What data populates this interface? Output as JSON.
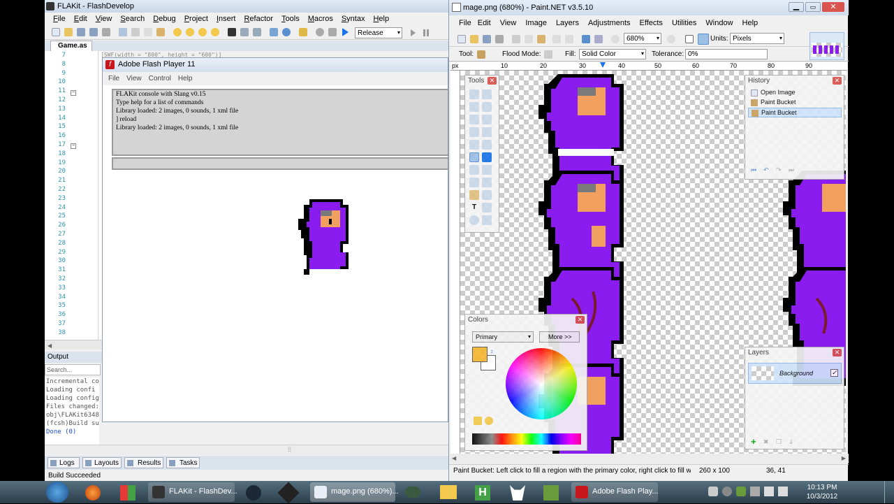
{
  "flashdevelop": {
    "title": "FLAKit - FlashDevelop",
    "menu": [
      "File",
      "Edit",
      "View",
      "Search",
      "Debug",
      "Project",
      "Insert",
      "Refactor",
      "Tools",
      "Macros",
      "Syntax",
      "Help"
    ],
    "config": "Release",
    "tab": "Game.as",
    "code_snippet": "[SWF(width = \"800\", height = \"600\")]",
    "line_numbers": [
      "7",
      "8",
      "9",
      "10",
      "11",
      "12",
      "13",
      "14",
      "15",
      "16",
      "17",
      "18",
      "19",
      "20",
      "21",
      "22",
      "23",
      "24",
      "25",
      "26",
      "27",
      "28",
      "29",
      "30",
      "31",
      "32",
      "33",
      "34",
      "35",
      "36",
      "37",
      "38"
    ],
    "output_title": "Output",
    "search_placeholder": "Search...",
    "output_lines": [
      "Incremental co",
      "Loading confi",
      "Loading config",
      "Files changed:",
      "obj\\FLAKit6348",
      "(fcsh)Build succeeded",
      "Done (0)"
    ],
    "bottom_tabs": [
      "Logs",
      "Layouts",
      "Results",
      "Tasks"
    ],
    "status": "Build Succeeded"
  },
  "flash_player": {
    "title": "Adobe Flash Player 11",
    "menu": [
      "File",
      "View",
      "Control",
      "Help"
    ],
    "console_lines": [
      "FLAKit console with Slang v0.15",
      "Type help for a list of commands",
      "Library loaded: 2 images, 0 sounds, 1 xml file",
      "] reload",
      "Library loaded: 2 images, 0 sounds, 1 xml file"
    ]
  },
  "paintnet": {
    "title": "mage.png (680%) - Paint.NET v3.5.10",
    "menu": [
      "File",
      "Edit",
      "View",
      "Image",
      "Layers",
      "Adjustments",
      "Effects",
      "Utilities",
      "Window",
      "Help"
    ],
    "zoom": "680%",
    "units_label": "Units:",
    "units": "Pixels",
    "tool_label": "Tool:",
    "flood_mode_label": "Flood Mode:",
    "fill_label": "Fill:",
    "fill": "Solid Color",
    "tolerance_label": "Tolerance:",
    "tolerance": "0%",
    "ruler_unit": "px",
    "ruler_ticks": [
      "10",
      "20",
      "30",
      "40",
      "50",
      "60",
      "70",
      "80",
      "90"
    ],
    "tools_title": "Tools",
    "history_title": "History",
    "history_items": [
      "Open Image",
      "Paint Bucket",
      "Paint Bucket"
    ],
    "colors_title": "Colors",
    "colors_mode": "Primary",
    "colors_more": "More >>",
    "layers_title": "Layers",
    "layer_name": "Background",
    "status_text": "Paint Bucket: Left click to fill a region with the primary color, right click to fill w",
    "image_size": "260 x 100",
    "cursor_pos": "36, 41",
    "primary_color": "#f5b731",
    "secondary_color": "#ffffff"
  },
  "taskbar": {
    "tasks": [
      "FLAKit - FlashDev...",
      "mage.png (680%)...",
      "Adobe Flash Play..."
    ],
    "time": "10:13 PM",
    "date": "10/3/2012"
  },
  "colors": {
    "sprite_purple": "#8a1cf0",
    "sprite_skin": "#f2a060",
    "sprite_gray": "#7a7a7a"
  }
}
